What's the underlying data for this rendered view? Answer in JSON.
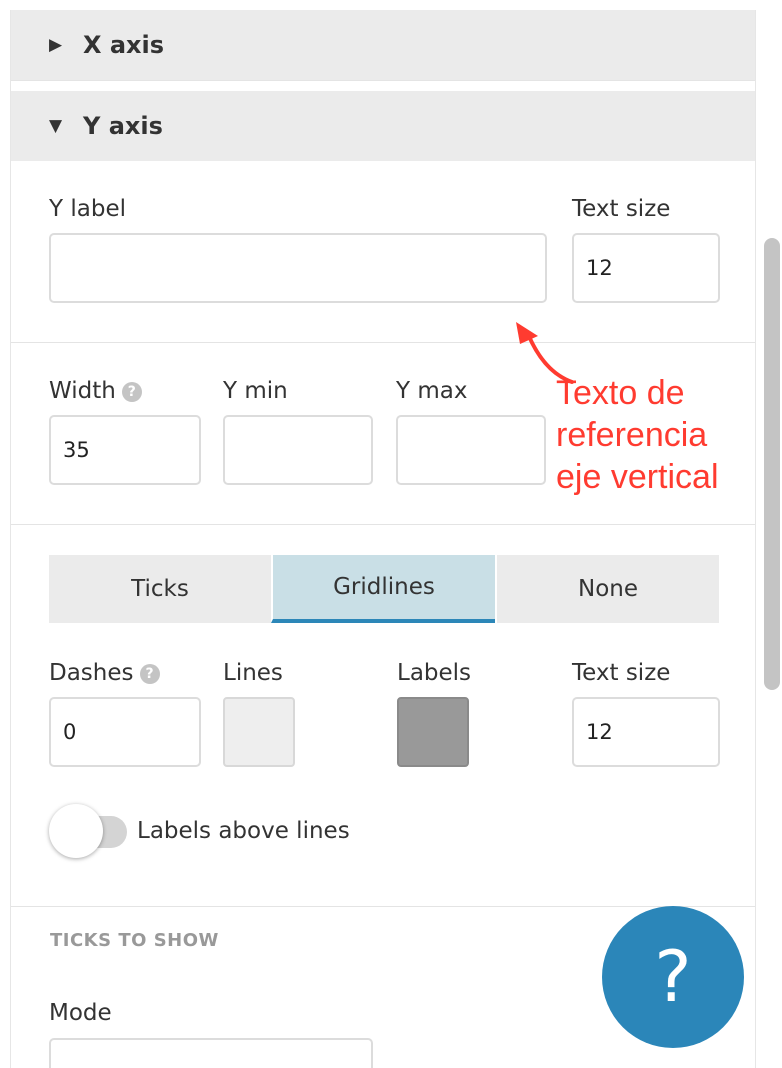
{
  "accordion": {
    "x_axis": {
      "title": "X axis",
      "expanded": false,
      "caret_icon": "caret-right-icon"
    },
    "y_axis": {
      "title": "Y axis",
      "expanded": true,
      "caret_icon": "caret-down-icon"
    }
  },
  "y_label": {
    "label": "Y label",
    "value": ""
  },
  "text_size_top": {
    "label": "Text size",
    "value": "12"
  },
  "width": {
    "label": "Width",
    "value": "35",
    "help_icon": "help-circle-icon",
    "help_glyph": "?"
  },
  "y_min": {
    "label": "Y min",
    "value": ""
  },
  "y_max": {
    "label": "Y max",
    "value": ""
  },
  "gridline_mode": {
    "options": [
      "Ticks",
      "Gridlines",
      "None"
    ],
    "selected": "Gridlines"
  },
  "dashes": {
    "label": "Dashes",
    "value": "0",
    "help_glyph": "?"
  },
  "lines": {
    "label": "Lines",
    "color": "#eeeeee"
  },
  "labels": {
    "label": "Labels",
    "color": "#999999"
  },
  "text_size_bottom": {
    "label": "Text size",
    "value": "12"
  },
  "labels_above_lines": {
    "label": "Labels above lines",
    "enabled": false
  },
  "ticks_to_show": {
    "title": "TICKS TO SHOW",
    "mode_label": "Mode"
  },
  "help_button": {
    "glyph": "?",
    "color": "#2b86b9"
  },
  "annotation": {
    "text": "Texto de\nreferencia\neje vertical",
    "color": "#ff3b30"
  },
  "colors": {
    "accent": "#2c87b8",
    "selected_bg": "#c9dfe6",
    "header_bg": "#ebebeb"
  }
}
